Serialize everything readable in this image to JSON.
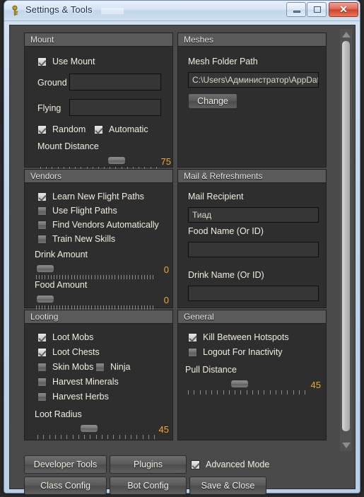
{
  "window": {
    "title": "Settings & Tools",
    "app_icon": "key-icon",
    "controls": {
      "minimize": "minimize-icon",
      "maximize": "maximize-icon",
      "close": "close-icon"
    }
  },
  "groups": {
    "mount": {
      "title": "Mount",
      "use_mount": {
        "label": "Use Mount",
        "checked": true
      },
      "ground_label": "Ground",
      "ground_value": "",
      "flying_label": "Flying",
      "flying_value": "",
      "random": {
        "label": "Random",
        "checked": true
      },
      "automatic": {
        "label": "Automatic",
        "checked": true
      },
      "mount_distance": {
        "label": "Mount Distance",
        "value": 75,
        "percent": 68,
        "ticks": 21
      }
    },
    "meshes": {
      "title": "Meshes",
      "mesh_folder_label": "Mesh Folder Path",
      "mesh_folder_value": "C:\\Users\\Администратор\\AppData\\",
      "change_label": "Change"
    },
    "vendors": {
      "title": "Vendors",
      "checks": [
        {
          "label": "Learn New Flight Paths",
          "checked": true
        },
        {
          "label": "Use Flight Paths",
          "checked": false
        },
        {
          "label": "Find Vendors Automatically",
          "checked": false
        },
        {
          "label": "Train New Skills",
          "checked": false
        }
      ],
      "drink_amount": {
        "label": "Drink Amount",
        "value": 0,
        "percent": 0,
        "ticks": 41
      },
      "food_amount": {
        "label": "Food Amount",
        "value": 0,
        "percent": 0,
        "ticks": 41
      }
    },
    "mail": {
      "title": "Mail & Refreshments",
      "recipient_label": "Mail Recipient",
      "recipient_value": "Тиад",
      "food_label": "Food Name (Or ID)",
      "food_value": "",
      "drink_label": "Drink Name (Or ID)",
      "drink_value": ""
    },
    "looting": {
      "title": "Looting",
      "checks": [
        {
          "label": "Loot Mobs",
          "checked": true
        },
        {
          "label": "Loot Chests",
          "checked": true
        },
        {
          "label": "Skin Mobs",
          "checked": false
        },
        {
          "label": "Ninja",
          "checked": false
        },
        {
          "label": "Harvest Minerals",
          "checked": false
        },
        {
          "label": "Harvest Herbs",
          "checked": false
        }
      ],
      "loot_radius": {
        "label": "Loot Radius",
        "value": 45,
        "percent": 43,
        "ticks": 21
      }
    },
    "general": {
      "title": "General",
      "checks": [
        {
          "label": "Kill Between Hotspots",
          "checked": true
        },
        {
          "label": "Logout For Inactivity",
          "checked": false
        }
      ],
      "pull_distance": {
        "label": "Pull Distance",
        "value": 45,
        "percent": 43,
        "ticks": 21
      }
    }
  },
  "footer": {
    "developer_tools": "Developer Tools",
    "plugins": "Plugins",
    "advanced_mode": {
      "label": "Advanced Mode",
      "checked": true
    },
    "class_config": "Class Config",
    "bot_config": "Bot Config",
    "save_close": "Save & Close"
  },
  "colors": {
    "accent_value": "#f0a830",
    "text": "#f2eddf",
    "panel_bg": "#2e2e2e",
    "header_bg": "#5a5a5a"
  }
}
